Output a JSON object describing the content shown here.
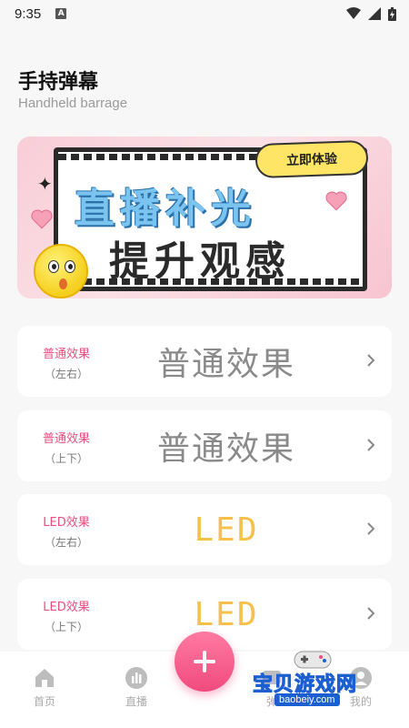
{
  "status_bar": {
    "time": "9:35",
    "indicator": "A"
  },
  "header": {
    "title": "手持弹幕",
    "subtitle": "Handheld barrage"
  },
  "banner": {
    "line1": "直播补光",
    "line2": "提升观感",
    "cta": "立即体验"
  },
  "cards": [
    {
      "label": "普通效果",
      "direction": "（左右）",
      "preview": "普通效果",
      "style": "normal"
    },
    {
      "label": "普通效果",
      "direction": "（上下）",
      "preview": "普通效果",
      "style": "normal"
    },
    {
      "label": "LED效果",
      "direction": "（左右）",
      "preview": "LED",
      "style": "led"
    },
    {
      "label": "LED效果",
      "direction": "（上下）",
      "preview": "LED",
      "style": "led"
    }
  ],
  "bottom_nav": {
    "items": [
      {
        "label": "首页",
        "icon": "home-icon"
      },
      {
        "label": "直播",
        "icon": "live-icon"
      },
      {
        "label": "弹",
        "icon": "barrage-icon"
      },
      {
        "label": "我的",
        "icon": "profile-icon"
      }
    ],
    "fab_icon": "plus-icon"
  },
  "watermark": {
    "title": "宝贝游戏网",
    "url": "baobeiy.com"
  },
  "colors": {
    "accent": "#f04a7f",
    "led": "#f6c04a",
    "label": "#e94f7d"
  }
}
